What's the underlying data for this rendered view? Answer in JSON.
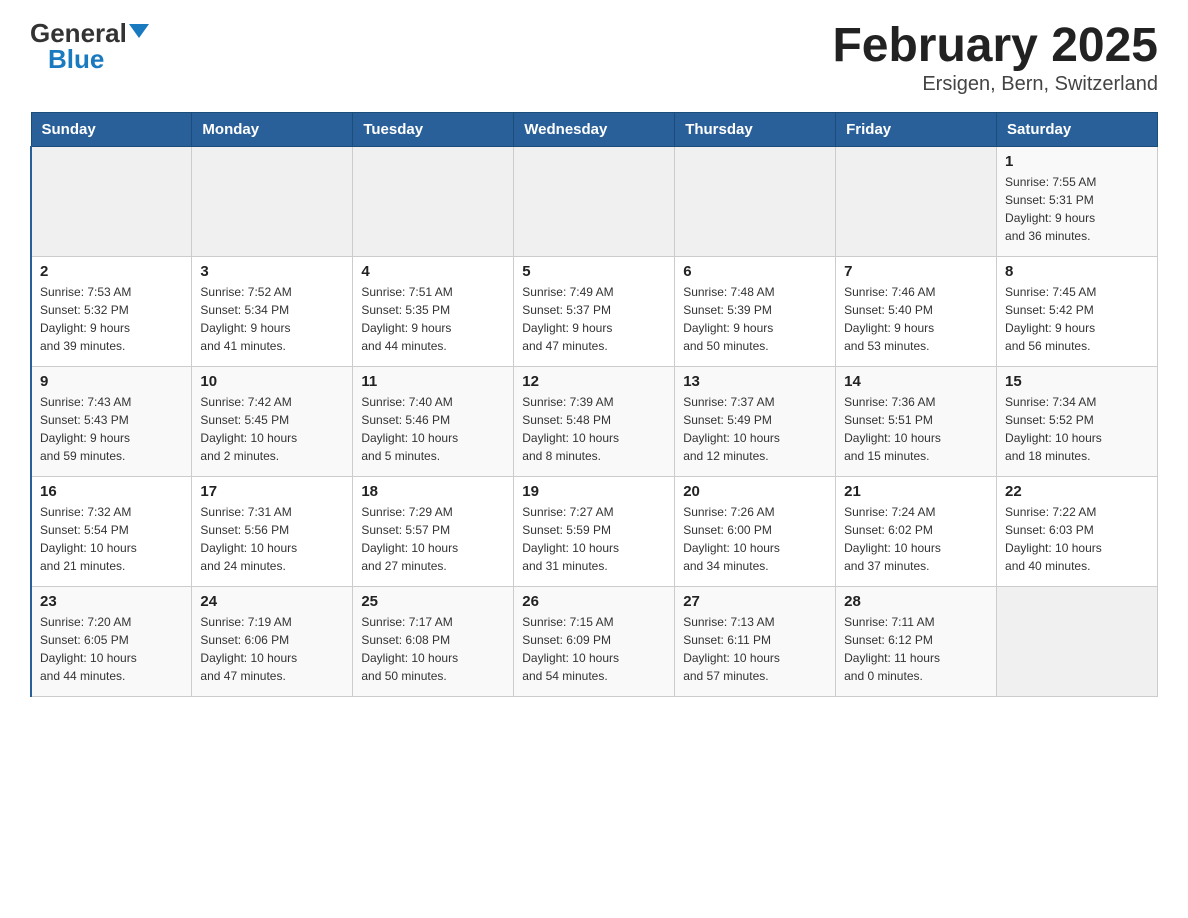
{
  "header": {
    "logo_general": "General",
    "logo_blue": "Blue",
    "title": "February 2025",
    "subtitle": "Ersigen, Bern, Switzerland"
  },
  "days_of_week": [
    "Sunday",
    "Monday",
    "Tuesday",
    "Wednesday",
    "Thursday",
    "Friday",
    "Saturday"
  ],
  "weeks": [
    [
      {
        "day": "",
        "info": ""
      },
      {
        "day": "",
        "info": ""
      },
      {
        "day": "",
        "info": ""
      },
      {
        "day": "",
        "info": ""
      },
      {
        "day": "",
        "info": ""
      },
      {
        "day": "",
        "info": ""
      },
      {
        "day": "1",
        "info": "Sunrise: 7:55 AM\nSunset: 5:31 PM\nDaylight: 9 hours\nand 36 minutes."
      }
    ],
    [
      {
        "day": "2",
        "info": "Sunrise: 7:53 AM\nSunset: 5:32 PM\nDaylight: 9 hours\nand 39 minutes."
      },
      {
        "day": "3",
        "info": "Sunrise: 7:52 AM\nSunset: 5:34 PM\nDaylight: 9 hours\nand 41 minutes."
      },
      {
        "day": "4",
        "info": "Sunrise: 7:51 AM\nSunset: 5:35 PM\nDaylight: 9 hours\nand 44 minutes."
      },
      {
        "day": "5",
        "info": "Sunrise: 7:49 AM\nSunset: 5:37 PM\nDaylight: 9 hours\nand 47 minutes."
      },
      {
        "day": "6",
        "info": "Sunrise: 7:48 AM\nSunset: 5:39 PM\nDaylight: 9 hours\nand 50 minutes."
      },
      {
        "day": "7",
        "info": "Sunrise: 7:46 AM\nSunset: 5:40 PM\nDaylight: 9 hours\nand 53 minutes."
      },
      {
        "day": "8",
        "info": "Sunrise: 7:45 AM\nSunset: 5:42 PM\nDaylight: 9 hours\nand 56 minutes."
      }
    ],
    [
      {
        "day": "9",
        "info": "Sunrise: 7:43 AM\nSunset: 5:43 PM\nDaylight: 9 hours\nand 59 minutes."
      },
      {
        "day": "10",
        "info": "Sunrise: 7:42 AM\nSunset: 5:45 PM\nDaylight: 10 hours\nand 2 minutes."
      },
      {
        "day": "11",
        "info": "Sunrise: 7:40 AM\nSunset: 5:46 PM\nDaylight: 10 hours\nand 5 minutes."
      },
      {
        "day": "12",
        "info": "Sunrise: 7:39 AM\nSunset: 5:48 PM\nDaylight: 10 hours\nand 8 minutes."
      },
      {
        "day": "13",
        "info": "Sunrise: 7:37 AM\nSunset: 5:49 PM\nDaylight: 10 hours\nand 12 minutes."
      },
      {
        "day": "14",
        "info": "Sunrise: 7:36 AM\nSunset: 5:51 PM\nDaylight: 10 hours\nand 15 minutes."
      },
      {
        "day": "15",
        "info": "Sunrise: 7:34 AM\nSunset: 5:52 PM\nDaylight: 10 hours\nand 18 minutes."
      }
    ],
    [
      {
        "day": "16",
        "info": "Sunrise: 7:32 AM\nSunset: 5:54 PM\nDaylight: 10 hours\nand 21 minutes."
      },
      {
        "day": "17",
        "info": "Sunrise: 7:31 AM\nSunset: 5:56 PM\nDaylight: 10 hours\nand 24 minutes."
      },
      {
        "day": "18",
        "info": "Sunrise: 7:29 AM\nSunset: 5:57 PM\nDaylight: 10 hours\nand 27 minutes."
      },
      {
        "day": "19",
        "info": "Sunrise: 7:27 AM\nSunset: 5:59 PM\nDaylight: 10 hours\nand 31 minutes."
      },
      {
        "day": "20",
        "info": "Sunrise: 7:26 AM\nSunset: 6:00 PM\nDaylight: 10 hours\nand 34 minutes."
      },
      {
        "day": "21",
        "info": "Sunrise: 7:24 AM\nSunset: 6:02 PM\nDaylight: 10 hours\nand 37 minutes."
      },
      {
        "day": "22",
        "info": "Sunrise: 7:22 AM\nSunset: 6:03 PM\nDaylight: 10 hours\nand 40 minutes."
      }
    ],
    [
      {
        "day": "23",
        "info": "Sunrise: 7:20 AM\nSunset: 6:05 PM\nDaylight: 10 hours\nand 44 minutes."
      },
      {
        "day": "24",
        "info": "Sunrise: 7:19 AM\nSunset: 6:06 PM\nDaylight: 10 hours\nand 47 minutes."
      },
      {
        "day": "25",
        "info": "Sunrise: 7:17 AM\nSunset: 6:08 PM\nDaylight: 10 hours\nand 50 minutes."
      },
      {
        "day": "26",
        "info": "Sunrise: 7:15 AM\nSunset: 6:09 PM\nDaylight: 10 hours\nand 54 minutes."
      },
      {
        "day": "27",
        "info": "Sunrise: 7:13 AM\nSunset: 6:11 PM\nDaylight: 10 hours\nand 57 minutes."
      },
      {
        "day": "28",
        "info": "Sunrise: 7:11 AM\nSunset: 6:12 PM\nDaylight: 11 hours\nand 0 minutes."
      },
      {
        "day": "",
        "info": ""
      }
    ]
  ]
}
